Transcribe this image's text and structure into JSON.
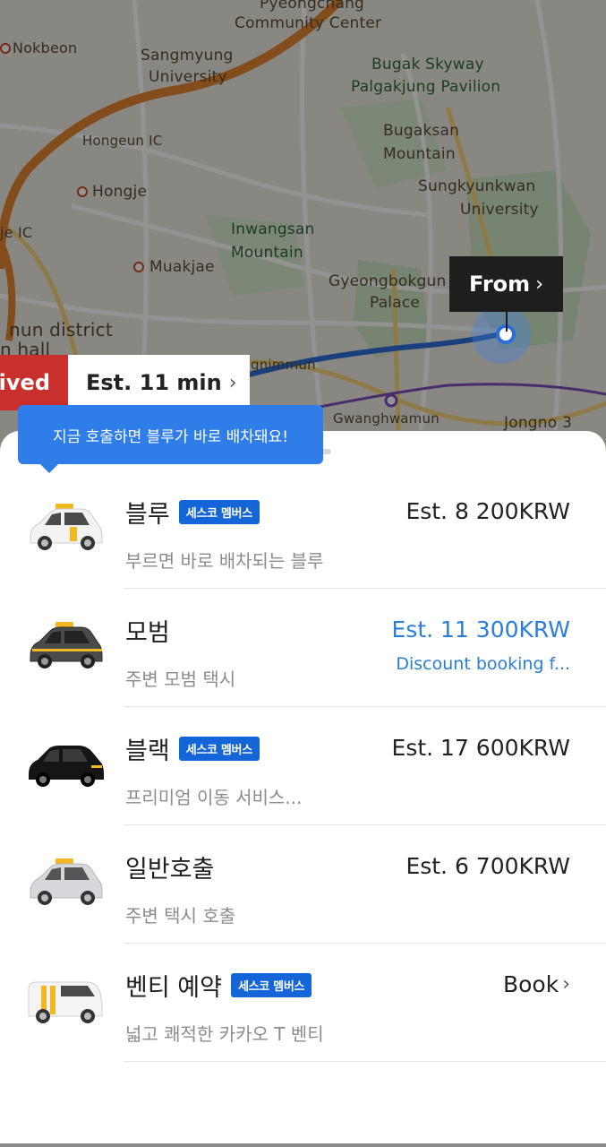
{
  "map": {
    "labels": {
      "pyeongchang_center_line1": "Pyeongchang",
      "pyeongchang_center_line2": "Community Center",
      "nokbeon": "Nokbeon",
      "sangmyung": "Sangmyung",
      "university": "University",
      "bugak_skyway": "Bugak Skyway",
      "palgakjung": "Palgakjung Pavilion",
      "hongeun_ic": "Hongeun IC",
      "ic_badge": "IC",
      "bugaksan": "Bugaksan",
      "mountain": "Mountain",
      "hongje": "Hongje",
      "sungkyunkwan": "Sungkyunkwan",
      "sungkyunkwan_univ": "University",
      "je_ic": "je IC",
      "inwangsan": "Inwangsan",
      "inwangsan_mtn": "Mountain",
      "muakjae": "Muakjae",
      "gyeongbokgung": "Gyeongbokgun",
      "palace": "Palace",
      "nun_district": "nun district",
      "hall": "n hall",
      "gnimmun": "gnimmun",
      "gwanghwamun": "Gwanghwamun",
      "jongno3": "Jongno 3"
    },
    "from_button": "From",
    "arrived_tag": "rived",
    "eta_tag": "Est. 11 min",
    "colors": {
      "route": "#2b6fd6",
      "highway": "#e0862d",
      "arrived": "#c9302c"
    }
  },
  "tooltip": "지금 호출하면 블루가 바로 배차돼요!",
  "services": [
    {
      "title": "블루",
      "badge": "세스코 멤버스",
      "subtitle": "부르면 바로 배차되는 블루",
      "price": "Est. 8 200KRW",
      "icon": "taxi-blue-icon"
    },
    {
      "title": "모범",
      "subtitle": "주변 모범 택시",
      "price": "Est. 11 300KRW",
      "discount": "Discount booking f...",
      "icon": "taxi-deluxe-icon"
    },
    {
      "title": "블랙",
      "badge": "세스코 멤버스",
      "subtitle": "프리미엄 이동 서비스...",
      "price": "Est. 17 600KRW",
      "icon": "taxi-black-icon"
    },
    {
      "title": "일반호출",
      "subtitle": "주변 택시 호출",
      "price": "Est. 6 700KRW",
      "icon": "taxi-normal-icon"
    },
    {
      "title": "벤티 예약",
      "badge": "세스코 멤버스",
      "subtitle": "넓고 쾌적한 카카오 T 벤티",
      "book": "Book",
      "icon": "taxi-venti-icon"
    }
  ]
}
